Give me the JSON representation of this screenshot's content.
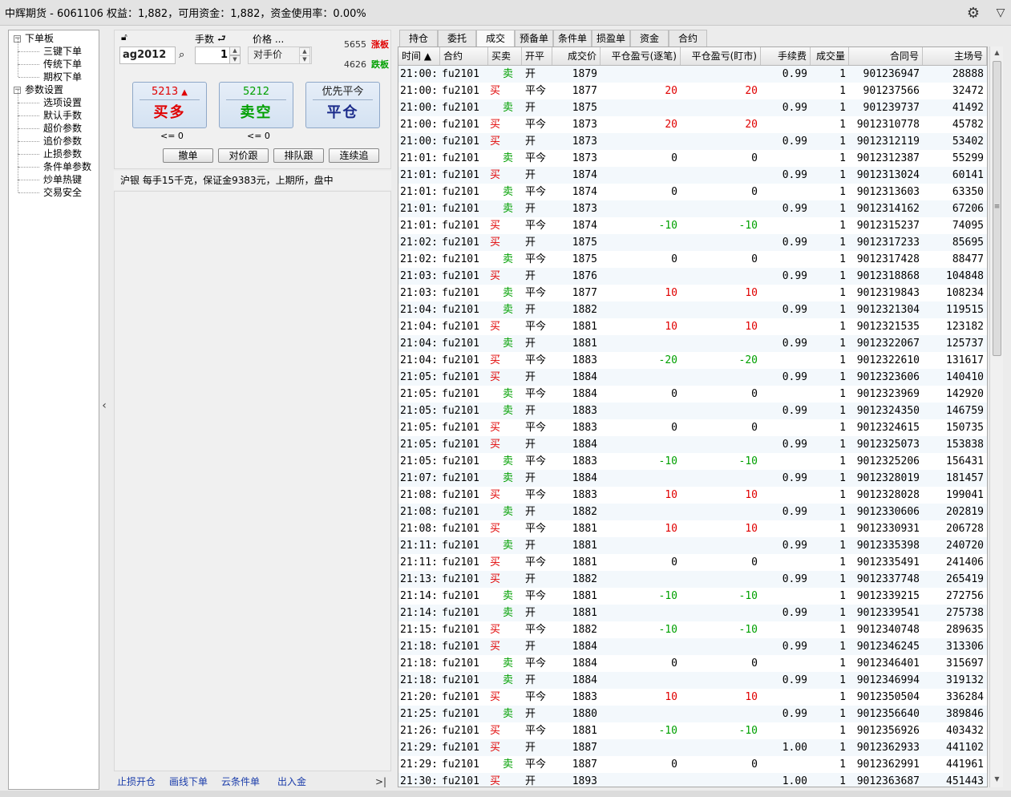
{
  "title": "中辉期货 - 6061106  权益：1,882，可用资金：1,882，资金使用率：0.00%",
  "tree": {
    "groups": [
      {
        "label": "下单板",
        "items": [
          "三键下单",
          "传统下单",
          "期权下单"
        ]
      },
      {
        "label": "参数设置",
        "items": [
          "选项设置",
          "默认手数",
          "超价参数",
          "追价参数",
          "止损参数",
          "条件单参数",
          "炒单热键",
          "交易安全"
        ]
      }
    ]
  },
  "order": {
    "qty_label": "手数",
    "price_label": "价格 ...",
    "symbol": "ag2012",
    "qty": "1",
    "price_mode": "对手价",
    "limit_up_value": "5655",
    "limit_up_label": "涨板",
    "limit_down_value": "4626",
    "limit_down_label": "跌板",
    "buy_price": "5213",
    "buy_arrow": "▲",
    "buy_label": "买多",
    "sell_price": "5212",
    "sell_label": "卖空",
    "close_top": "优先平今",
    "close_label": "平仓",
    "buy_cond": "<= 0",
    "sell_cond": "<= 0",
    "buttons": [
      "撤单",
      "对价跟",
      "排队跟",
      "连续追"
    ]
  },
  "info": "沪银  每手15千克，保证金9383元，上期所，盘中",
  "bottom_links": [
    "止损开仓",
    "画线下单",
    "云条件单",
    "出入金"
  ],
  "bottom_more": ">|",
  "tabs": [
    "持仓",
    "委托",
    "成交",
    "预备单",
    "条件单",
    "损盈单",
    "资金",
    "合约"
  ],
  "active_tab": 2,
  "columns": [
    "时间 ▲",
    "合约",
    "买卖",
    "开平",
    "成交价",
    "平仓盈亏(逐笔)",
    "平仓盈亏(盯市)",
    "手续费",
    "成交量",
    "合同号",
    "主场号"
  ],
  "colors": {
    "buy": "#e00000",
    "sell": "#00a000"
  },
  "rows": [
    [
      "21:00:",
      "fu2101",
      "卖",
      "开",
      "1879",
      "",
      "",
      "0.99",
      "1",
      "901236947",
      "28888"
    ],
    [
      "21:00:",
      "fu2101",
      "买",
      "平今",
      "1877",
      "20",
      "20",
      "",
      "1",
      "901237566",
      "32472"
    ],
    [
      "21:00:",
      "fu2101",
      "卖",
      "开",
      "1875",
      "",
      "",
      "0.99",
      "1",
      "901239737",
      "41492"
    ],
    [
      "21:00:",
      "fu2101",
      "买",
      "平今",
      "1873",
      "20",
      "20",
      "",
      "1",
      "9012310778",
      "45782"
    ],
    [
      "21:00:",
      "fu2101",
      "买",
      "开",
      "1873",
      "",
      "",
      "0.99",
      "1",
      "9012312119",
      "53402"
    ],
    [
      "21:01:",
      "fu2101",
      "卖",
      "平今",
      "1873",
      "0",
      "0",
      "",
      "1",
      "9012312387",
      "55299"
    ],
    [
      "21:01:",
      "fu2101",
      "买",
      "开",
      "1874",
      "",
      "",
      "0.99",
      "1",
      "9012313024",
      "60141"
    ],
    [
      "21:01:",
      "fu2101",
      "卖",
      "平今",
      "1874",
      "0",
      "0",
      "",
      "1",
      "9012313603",
      "63350"
    ],
    [
      "21:01:",
      "fu2101",
      "卖",
      "开",
      "1873",
      "",
      "",
      "0.99",
      "1",
      "9012314162",
      "67206"
    ],
    [
      "21:01:",
      "fu2101",
      "买",
      "平今",
      "1874",
      "-10",
      "-10",
      "",
      "1",
      "9012315237",
      "74095"
    ],
    [
      "21:02:",
      "fu2101",
      "买",
      "开",
      "1875",
      "",
      "",
      "0.99",
      "1",
      "9012317233",
      "85695"
    ],
    [
      "21:02:",
      "fu2101",
      "卖",
      "平今",
      "1875",
      "0",
      "0",
      "",
      "1",
      "9012317428",
      "88477"
    ],
    [
      "21:03:",
      "fu2101",
      "买",
      "开",
      "1876",
      "",
      "",
      "0.99",
      "1",
      "9012318868",
      "104848"
    ],
    [
      "21:03:",
      "fu2101",
      "卖",
      "平今",
      "1877",
      "10",
      "10",
      "",
      "1",
      "9012319843",
      "108234"
    ],
    [
      "21:04:",
      "fu2101",
      "卖",
      "开",
      "1882",
      "",
      "",
      "0.99",
      "1",
      "9012321304",
      "119515"
    ],
    [
      "21:04:",
      "fu2101",
      "买",
      "平今",
      "1881",
      "10",
      "10",
      "",
      "1",
      "9012321535",
      "123182"
    ],
    [
      "21:04:",
      "fu2101",
      "卖",
      "开",
      "1881",
      "",
      "",
      "0.99",
      "1",
      "9012322067",
      "125737"
    ],
    [
      "21:04:",
      "fu2101",
      "买",
      "平今",
      "1883",
      "-20",
      "-20",
      "",
      "1",
      "9012322610",
      "131617"
    ],
    [
      "21:05:",
      "fu2101",
      "买",
      "开",
      "1884",
      "",
      "",
      "0.99",
      "1",
      "9012323606",
      "140410"
    ],
    [
      "21:05:",
      "fu2101",
      "卖",
      "平今",
      "1884",
      "0",
      "0",
      "",
      "1",
      "9012323969",
      "142920"
    ],
    [
      "21:05:",
      "fu2101",
      "卖",
      "开",
      "1883",
      "",
      "",
      "0.99",
      "1",
      "9012324350",
      "146759"
    ],
    [
      "21:05:",
      "fu2101",
      "买",
      "平今",
      "1883",
      "0",
      "0",
      "",
      "1",
      "9012324615",
      "150735"
    ],
    [
      "21:05:",
      "fu2101",
      "买",
      "开",
      "1884",
      "",
      "",
      "0.99",
      "1",
      "9012325073",
      "153838"
    ],
    [
      "21:05:",
      "fu2101",
      "卖",
      "平今",
      "1883",
      "-10",
      "-10",
      "",
      "1",
      "9012325206",
      "156431"
    ],
    [
      "21:07:",
      "fu2101",
      "卖",
      "开",
      "1884",
      "",
      "",
      "0.99",
      "1",
      "9012328019",
      "181457"
    ],
    [
      "21:08:",
      "fu2101",
      "买",
      "平今",
      "1883",
      "10",
      "10",
      "",
      "1",
      "9012328028",
      "199041"
    ],
    [
      "21:08:",
      "fu2101",
      "卖",
      "开",
      "1882",
      "",
      "",
      "0.99",
      "1",
      "9012330606",
      "202819"
    ],
    [
      "21:08:",
      "fu2101",
      "买",
      "平今",
      "1881",
      "10",
      "10",
      "",
      "1",
      "9012330931",
      "206728"
    ],
    [
      "21:11:",
      "fu2101",
      "卖",
      "开",
      "1881",
      "",
      "",
      "0.99",
      "1",
      "9012335398",
      "240720"
    ],
    [
      "21:11:",
      "fu2101",
      "买",
      "平今",
      "1881",
      "0",
      "0",
      "",
      "1",
      "9012335491",
      "241406"
    ],
    [
      "21:13:",
      "fu2101",
      "买",
      "开",
      "1882",
      "",
      "",
      "0.99",
      "1",
      "9012337748",
      "265419"
    ],
    [
      "21:14:",
      "fu2101",
      "卖",
      "平今",
      "1881",
      "-10",
      "-10",
      "",
      "1",
      "9012339215",
      "272756"
    ],
    [
      "21:14:",
      "fu2101",
      "卖",
      "开",
      "1881",
      "",
      "",
      "0.99",
      "1",
      "9012339541",
      "275738"
    ],
    [
      "21:15:",
      "fu2101",
      "买",
      "平今",
      "1882",
      "-10",
      "-10",
      "",
      "1",
      "9012340748",
      "289635"
    ],
    [
      "21:18:",
      "fu2101",
      "买",
      "开",
      "1884",
      "",
      "",
      "0.99",
      "1",
      "9012346245",
      "313306"
    ],
    [
      "21:18:",
      "fu2101",
      "卖",
      "平今",
      "1884",
      "0",
      "0",
      "",
      "1",
      "9012346401",
      "315697"
    ],
    [
      "21:18:",
      "fu2101",
      "卖",
      "开",
      "1884",
      "",
      "",
      "0.99",
      "1",
      "9012346994",
      "319132"
    ],
    [
      "21:20:",
      "fu2101",
      "买",
      "平今",
      "1883",
      "10",
      "10",
      "",
      "1",
      "9012350504",
      "336284"
    ],
    [
      "21:25:",
      "fu2101",
      "卖",
      "开",
      "1880",
      "",
      "",
      "0.99",
      "1",
      "9012356640",
      "389846"
    ],
    [
      "21:26:",
      "fu2101",
      "买",
      "平今",
      "1881",
      "-10",
      "-10",
      "",
      "1",
      "9012356926",
      "403432"
    ],
    [
      "21:29:",
      "fu2101",
      "买",
      "开",
      "1887",
      "",
      "",
      "1.00",
      "1",
      "9012362933",
      "441102"
    ],
    [
      "21:29:",
      "fu2101",
      "卖",
      "平今",
      "1887",
      "0",
      "0",
      "",
      "1",
      "9012362991",
      "441961"
    ],
    [
      "21:30:",
      "fu2101",
      "买",
      "开",
      "1893",
      "",
      "",
      "1.00",
      "1",
      "9012363687",
      "451443"
    ]
  ]
}
